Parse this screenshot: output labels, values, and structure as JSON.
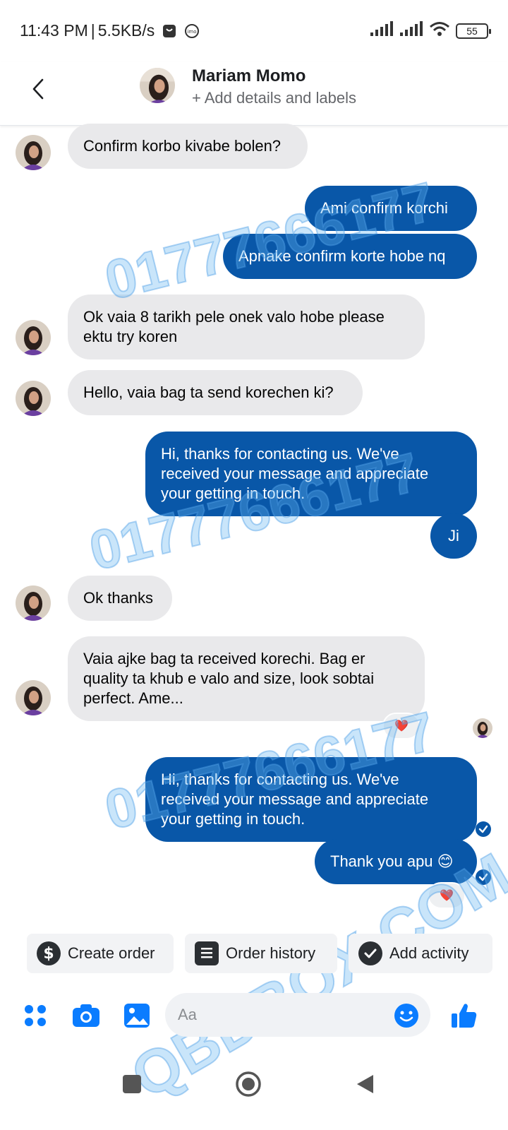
{
  "status_bar": {
    "time": "11:43 PM",
    "separator": "|",
    "speed": "5.5KB/s",
    "battery": "55",
    "icons": [
      "shopping-bag-icon",
      "imo-icon",
      "signal-icon",
      "signal-icon",
      "wifi-icon",
      "battery-icon"
    ]
  },
  "header": {
    "contact_name": "Mariam Momo",
    "subtitle": "+ Add details and labels"
  },
  "messages": [
    {
      "direction": "in",
      "text": "Confirm korbo kivabe bolen?"
    },
    {
      "direction": "out",
      "text": "Ami confirm korchi"
    },
    {
      "direction": "out",
      "text": "Apnake confirm korte hobe nq"
    },
    {
      "direction": "in",
      "text": "Ok vaia 8 tarikh pele onek valo hobe please ektu try koren"
    },
    {
      "direction": "in",
      "text": "Hello, vaia bag ta send korechen ki?"
    },
    {
      "direction": "out",
      "text": "Hi, thanks for contacting us. We've received your message and appreciate your getting in touch."
    },
    {
      "direction": "out",
      "text": "Ji"
    },
    {
      "direction": "in",
      "text": "Ok thanks"
    },
    {
      "direction": "in",
      "text": "Vaia ajke bag ta received korechi. Bag er quality ta khub e valo and size, look sobtai perfect. Ame...",
      "reaction": "❤️"
    },
    {
      "direction": "out",
      "text": "Hi, thanks for contacting us. We've received your message and appreciate your getting in touch.",
      "status": "seen"
    },
    {
      "direction": "out",
      "text": "Thank you apu 😊",
      "reaction": "❤️",
      "status": "seen"
    }
  ],
  "watermarks": [
    "01777666177",
    "01777666177",
    "01777666177",
    "QBDBOX.COM"
  ],
  "quick_actions": [
    {
      "label": "Create order",
      "icon": "dollar-icon"
    },
    {
      "label": "Order history",
      "icon": "list-icon"
    },
    {
      "label": "Add activity",
      "icon": "check-icon"
    }
  ],
  "composer": {
    "placeholder": "Aa",
    "icons": [
      "apps-icon",
      "camera-icon",
      "gallery-icon",
      "emoji-icon",
      "thumbs-up-icon"
    ]
  },
  "colors": {
    "outgoing_bubble": "#0957a8",
    "incoming_bubble": "#e9e9eb",
    "accent": "#0a7cff",
    "watermark": "#6ab4f0"
  }
}
